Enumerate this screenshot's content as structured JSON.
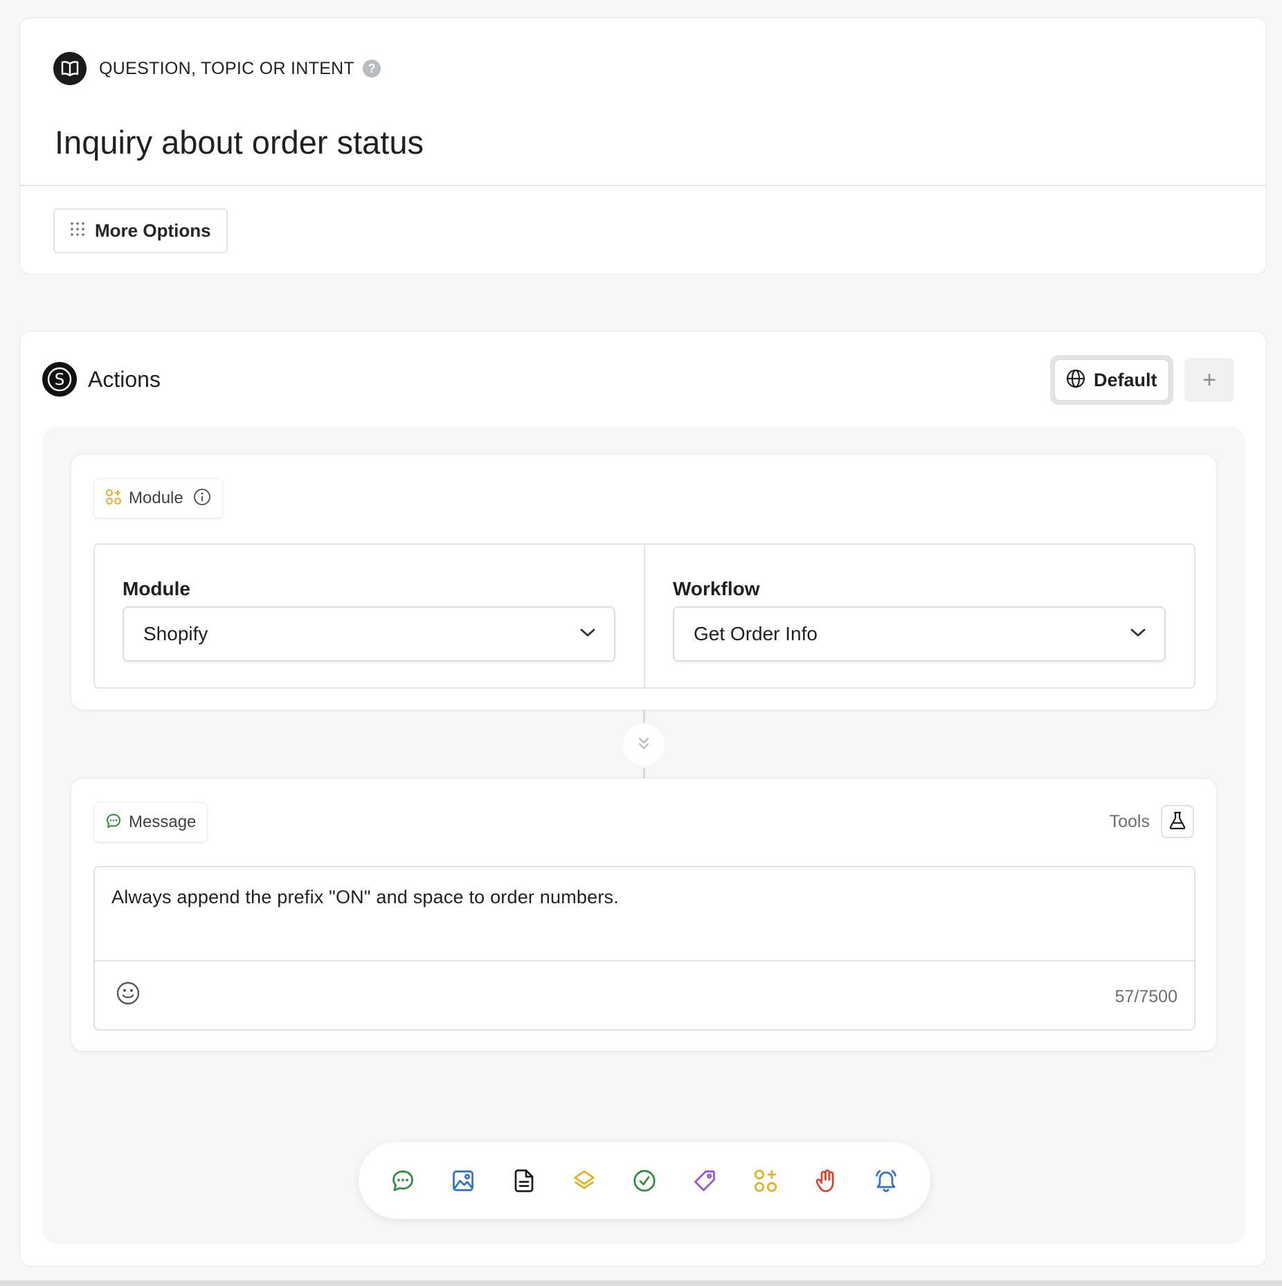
{
  "intent": {
    "label": "QUESTION, TOPIC OR INTENT",
    "help_glyph": "?",
    "title": "Inquiry about order status",
    "more_options_label": "More Options"
  },
  "actions": {
    "title": "Actions",
    "default_label": "Default",
    "add_glyph": "+"
  },
  "module_step": {
    "chip_label": "Module",
    "module_field_label": "Module",
    "module_value": "Shopify",
    "workflow_field_label": "Workflow",
    "workflow_value": "Get Order Info"
  },
  "message_step": {
    "chip_label": "Message",
    "tools_label": "Tools",
    "text": "Always append the prefix \"ON\" and space to order numbers.",
    "char_count": "57/7500"
  },
  "toolbar": {
    "icons": [
      "message-icon",
      "image-icon",
      "document-icon",
      "layers-icon",
      "check-circle-icon",
      "tag-icon",
      "module-icon",
      "hand-icon",
      "bell-icon"
    ]
  },
  "colors": {
    "green": "#2e8b3d",
    "blue": "#2f6fd0",
    "yellow": "#e8b020",
    "purple": "#9b4dd6",
    "red": "#d8432b",
    "dark": "#1b1b1d"
  }
}
